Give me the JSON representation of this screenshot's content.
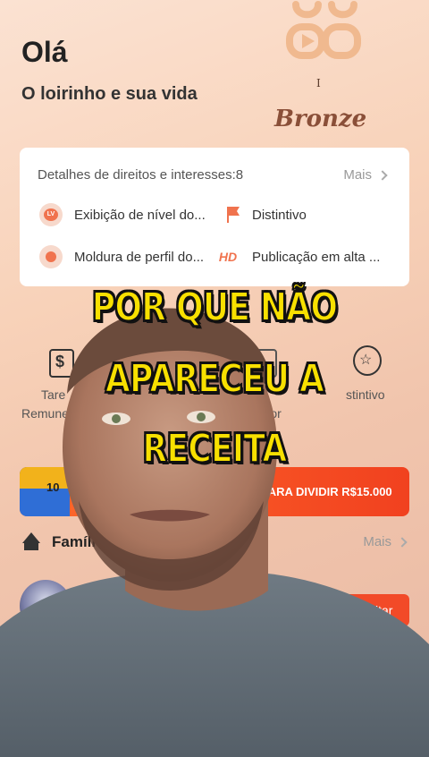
{
  "header": {
    "greeting": "Olá",
    "username": "O loirinho e sua vida",
    "badge_roman": "I",
    "badge_tier": "Bronze"
  },
  "rights_card": {
    "title": "Detalhes de direitos e interesses:8",
    "more_label": "Mais",
    "perks": [
      {
        "label": "Exibição de nível do...",
        "icon": "level-icon"
      },
      {
        "label": "Distintivo",
        "icon": "flag-icon"
      },
      {
        "label": "Moldura de perfil do...",
        "icon": "frame-icon"
      },
      {
        "label": "Publicação em alta ...",
        "icon": "hd-icon",
        "icon_text": "HD"
      }
    ]
  },
  "quick_row": {
    "left_label_1": "Tare",
    "left_label_2": "Remune",
    "mid_label": "criador",
    "right_label": "stintivo"
  },
  "banner": {
    "number": "10",
    "text": "PARA DIVIDIR R$15.000"
  },
  "family": {
    "label": "Famíli",
    "more_label": "Mais",
    "apply_label": "Solicitar"
  },
  "caption": {
    "line1": "POR QUE NÃO",
    "line2": "APARECEU A",
    "line3": "RECEITA"
  },
  "colors": {
    "accent": "#f24a28",
    "caption_fill": "#f8e000",
    "badge_tier": "#8a4f38"
  }
}
